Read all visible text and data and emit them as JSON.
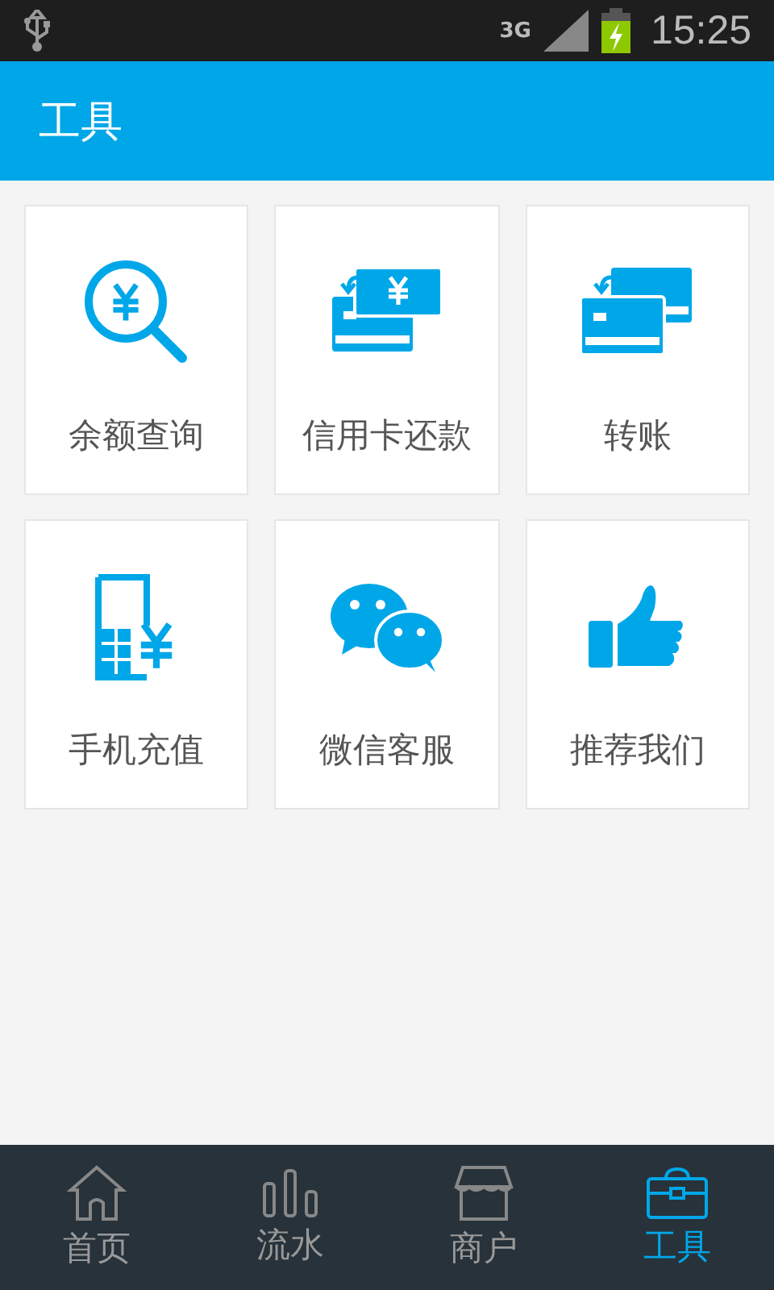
{
  "status_bar": {
    "network": "3G",
    "time": "15:25"
  },
  "header": {
    "title": "工具"
  },
  "tiles": [
    {
      "kind": "balance",
      "label": "余额查询"
    },
    {
      "kind": "credit",
      "label": "信用卡还款"
    },
    {
      "kind": "transfer",
      "label": "转账"
    },
    {
      "kind": "topup",
      "label": "手机充值"
    },
    {
      "kind": "wechat",
      "label": "微信客服"
    },
    {
      "kind": "recommend",
      "label": "推荐我们"
    }
  ],
  "tabs": [
    {
      "kind": "home",
      "label": "首页",
      "selected": false
    },
    {
      "kind": "flow",
      "label": "流水",
      "selected": false
    },
    {
      "kind": "shop",
      "label": "商户",
      "selected": false
    },
    {
      "kind": "tools",
      "label": "工具",
      "selected": true
    }
  ]
}
